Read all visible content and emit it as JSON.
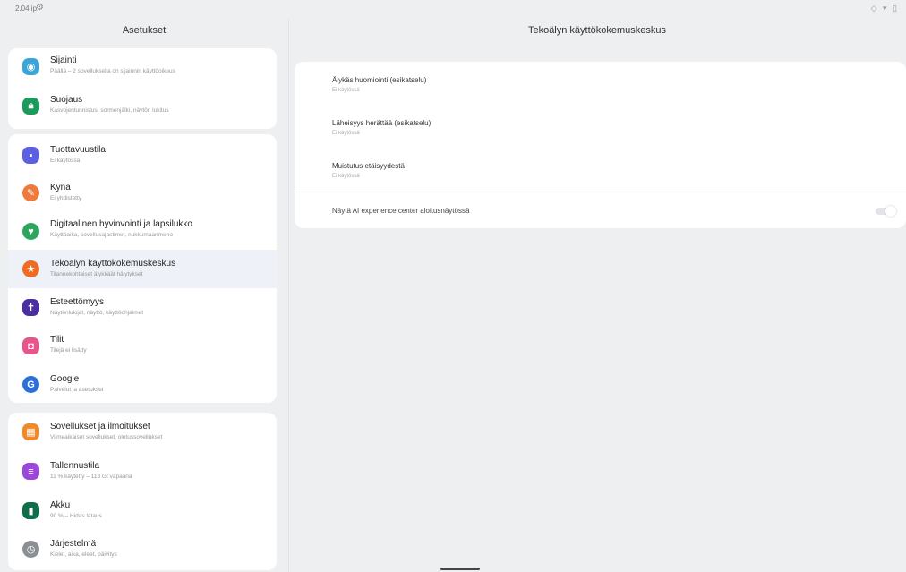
{
  "status": {
    "time": "2.04 ip.",
    "right_icons": "◇ ▾ ▯"
  },
  "left_title": "Asetukset",
  "right_title": "Tekoälyn käyttökokemuskeskus",
  "groups": [
    {
      "items": [
        {
          "title": "Sijainti",
          "subtitle": "Päällä – 2 sovelluksella on sijainnin käyttöoikeus",
          "icon": "location-icon",
          "color": "#3aa6d8"
        },
        {
          "title": "Suojaus",
          "subtitle": "Kasvojentunnistus, sormenjälki, näytön lukitus",
          "icon": "lock-icon",
          "color": "#1b9a5b"
        }
      ]
    },
    {
      "items": [
        {
          "title": "Tuottavuustila",
          "subtitle": "Ei käytössä",
          "icon": "productivity-icon",
          "color": "#5b5fe0"
        },
        {
          "title": "Kynä",
          "subtitle": "Ei yhdistetty",
          "icon": "pen-icon",
          "color": "#f07a3c"
        },
        {
          "title": "Digitaalinen hyvinvointi ja lapsilukko",
          "subtitle": "Käyttöaika, sovellusajastimet, nukkumaanmeno",
          "icon": "wellbeing-icon",
          "color": "#2ea55f"
        },
        {
          "title": "Tekoälyn käyttökokemuskeskus",
          "subtitle": "Tilannekohtaiset älykkäät hälytykset",
          "icon": "star-icon",
          "color": "#f06a22",
          "selected": true
        },
        {
          "title": "Esteettömyys",
          "subtitle": "Näytönlukijat, näyttö, käyttöohjaimet",
          "icon": "accessibility-icon",
          "color": "#4b2fa0"
        },
        {
          "title": "Tilit",
          "subtitle": "Tilejä ei lisätty",
          "icon": "account-icon",
          "color": "#e8558c"
        },
        {
          "title": "Google",
          "subtitle": "Palvelut ja asetukset",
          "icon": "google-icon",
          "color": "#2c6fd8"
        }
      ]
    },
    {
      "items": [
        {
          "title": "Sovellukset ja ilmoitukset",
          "subtitle": "Viimeaikaiset sovellukset, oletussovellukset",
          "icon": "apps-icon",
          "color": "#f08a28"
        },
        {
          "title": "Tallennustila",
          "subtitle": "11 % käytetty – 113 Gt vapaana",
          "icon": "storage-icon",
          "color": "#9b47d9"
        },
        {
          "title": "Akku",
          "subtitle": "90 % – Hidas lataus",
          "icon": "battery-icon",
          "color": "#0f6e4a"
        },
        {
          "title": "Järjestelmä",
          "subtitle": "Kielet, aika, eleet, päivitys",
          "icon": "info-icon",
          "color": "#8a8f96"
        }
      ]
    }
  ],
  "right_items": [
    {
      "title": "Älykäs huomiointi (esikatselu)",
      "subtitle": "Ei käytössä"
    },
    {
      "title": "Läheisyys herättää (esikatselu)",
      "subtitle": "Ei käytössä"
    },
    {
      "title": "Muistutus etäisyydestä",
      "subtitle": "Ei käytössä"
    }
  ],
  "toggle_item": {
    "title": "Näytä AI experience center aloitusnäytössä",
    "enabled": false
  }
}
